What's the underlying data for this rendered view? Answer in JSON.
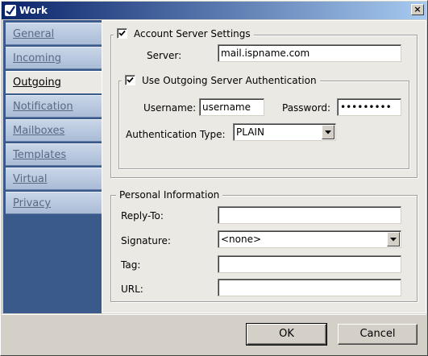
{
  "window": {
    "title": "Work",
    "close_glyph": "×"
  },
  "sidebar": {
    "items": [
      {
        "label": "General",
        "active": false
      },
      {
        "label": "Incoming",
        "active": false
      },
      {
        "label": "Outgoing",
        "active": true
      },
      {
        "label": "Notification",
        "active": false
      },
      {
        "label": "Mailboxes",
        "active": false
      },
      {
        "label": "Templates",
        "active": false
      },
      {
        "label": "Virtual",
        "active": false
      },
      {
        "label": "Privacy",
        "active": false
      }
    ]
  },
  "account": {
    "legend": "Account Server Settings",
    "checked": true,
    "server_label": "Server:",
    "server_value": "mail.ispname.com",
    "auth": {
      "legend": "Use Outgoing Server Authentication",
      "checked": true,
      "username_label": "Username:",
      "username_value": "username",
      "password_label": "Password:",
      "password_value": "•••••••••",
      "type_label": "Authentication Type:",
      "type_value": "PLAIN"
    }
  },
  "personal": {
    "legend": "Personal Information",
    "reply_to_label": "Reply-To:",
    "reply_to_value": "",
    "signature_label": "Signature:",
    "signature_value": "<none>",
    "tag_label": "Tag:",
    "tag_value": "",
    "url_label": "URL:",
    "url_value": ""
  },
  "buttons": {
    "ok": "OK",
    "cancel": "Cancel"
  },
  "icons": {
    "title_icon": "app-logo-icon",
    "dropdown": "chevron-down-icon",
    "check": "checkmark-icon"
  },
  "colors": {
    "titlebar": "#0a246a",
    "sidebar": "#3a5a8c",
    "panel": "#ebe9e3"
  }
}
